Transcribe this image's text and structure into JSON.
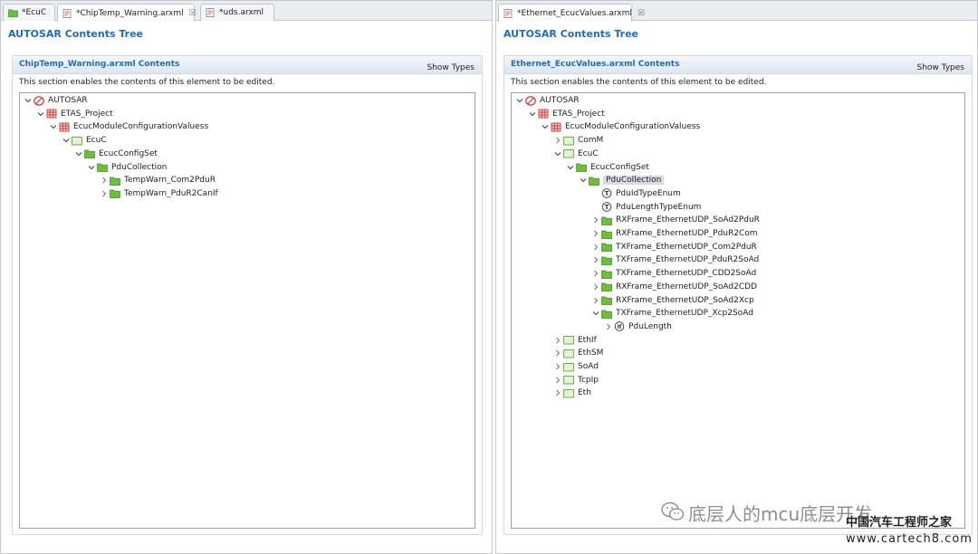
{
  "left_editor": {
    "tabs": [
      {
        "label": "*EcuC",
        "icon": "folder-icon",
        "closable": false
      },
      {
        "label": "*ChipTemp_Warning.arxml",
        "icon": "arxml-file-icon",
        "closable": true
      },
      {
        "label": "*uds.arxml",
        "icon": "arxml-file-icon",
        "closable": false
      }
    ],
    "close_glyph": "☒",
    "title": "AUTOSAR Contents Tree",
    "section_title": "ChipTemp_Warning.arxml Contents",
    "show_types": "Show Types",
    "description": "This section enables the contents of this element to be edited.",
    "tree": [
      {
        "label": "AUTOSAR",
        "depth": 0,
        "icon": "autosar-icon",
        "expander": "expanded"
      },
      {
        "label": "ETAS_Project",
        "depth": 1,
        "icon": "package-icon",
        "expander": "expanded"
      },
      {
        "label": "EcucModuleConfigurationValuess",
        "depth": 2,
        "icon": "package-icon",
        "expander": "expanded"
      },
      {
        "label": "EcuC",
        "depth": 3,
        "icon": "module-icon",
        "expander": "expanded"
      },
      {
        "label": "EcucConfigSet",
        "depth": 4,
        "icon": "folder-icon",
        "expander": "expanded"
      },
      {
        "label": "PduCollection",
        "depth": 5,
        "icon": "folder-icon",
        "expander": "expanded"
      },
      {
        "label": "TempWarn_Com2PduR",
        "depth": 6,
        "icon": "folder-icon",
        "expander": "collapsed"
      },
      {
        "label": "TempWarn_PduR2CanIf",
        "depth": 6,
        "icon": "folder-icon",
        "expander": "collapsed"
      }
    ]
  },
  "right_editor": {
    "tabs": [
      {
        "label": "*Ethernet_EcucValues.arxml",
        "icon": "arxml-file-icon",
        "closable": true
      }
    ],
    "close_glyph": "☒",
    "title": "AUTOSAR Contents Tree",
    "section_title": "Ethernet_EcucValues.arxml Contents",
    "show_types": "Show Types",
    "description": "This section enables the contents of this element to be edited.",
    "tree": [
      {
        "label": "AUTOSAR",
        "depth": 0,
        "icon": "autosar-icon",
        "expander": "expanded"
      },
      {
        "label": "ETAS_Project",
        "depth": 1,
        "icon": "package-icon",
        "expander": "expanded"
      },
      {
        "label": "EcucModuleConfigurationValuess",
        "depth": 2,
        "icon": "package-icon",
        "expander": "expanded"
      },
      {
        "label": "ComM",
        "depth": 3,
        "icon": "module-icon",
        "expander": "collapsed"
      },
      {
        "label": "EcuC",
        "depth": 3,
        "icon": "module-icon",
        "expander": "expanded"
      },
      {
        "label": "EcucConfigSet",
        "depth": 4,
        "icon": "folder-icon",
        "expander": "expanded"
      },
      {
        "label": "PduCollection",
        "depth": 5,
        "icon": "folder-icon",
        "expander": "expanded",
        "selected": true
      },
      {
        "label": "PduIdTypeEnum",
        "depth": 6,
        "icon": "enum-param-icon",
        "expander": "none"
      },
      {
        "label": "PduLengthTypeEnum",
        "depth": 6,
        "icon": "enum-param-icon",
        "expander": "none"
      },
      {
        "label": "RXFrame_EthernetUDP_SoAd2PduR",
        "depth": 6,
        "icon": "folder-icon",
        "expander": "collapsed"
      },
      {
        "label": "RXFrame_EthernetUDP_PduR2Com",
        "depth": 6,
        "icon": "folder-icon",
        "expander": "collapsed"
      },
      {
        "label": "TXFrame_EthernetUDP_Com2PduR",
        "depth": 6,
        "icon": "folder-icon",
        "expander": "collapsed"
      },
      {
        "label": "TXFrame_EthernetUDP_PduR2SoAd",
        "depth": 6,
        "icon": "folder-icon",
        "expander": "collapsed"
      },
      {
        "label": "TXFrame_EthernetUDP_CDD2SoAd",
        "depth": 6,
        "icon": "folder-icon",
        "expander": "collapsed"
      },
      {
        "label": "RXFrame_EthernetUDP_SoAd2CDD",
        "depth": 6,
        "icon": "folder-icon",
        "expander": "collapsed"
      },
      {
        "label": "RXFrame_EthernetUDP_SoAd2Xcp",
        "depth": 6,
        "icon": "folder-icon",
        "expander": "collapsed"
      },
      {
        "label": "TXFrame_EthernetUDP_Xcp2SoAd",
        "depth": 6,
        "icon": "folder-icon",
        "expander": "expanded"
      },
      {
        "label": "PduLength",
        "depth": 7,
        "icon": "int-param-icon",
        "expander": "collapsed"
      },
      {
        "label": "EthIf",
        "depth": 3,
        "icon": "module-icon",
        "expander": "collapsed"
      },
      {
        "label": "EthSM",
        "depth": 3,
        "icon": "module-icon",
        "expander": "collapsed"
      },
      {
        "label": "SoAd",
        "depth": 3,
        "icon": "module-icon",
        "expander": "collapsed"
      },
      {
        "label": "TcpIp",
        "depth": 3,
        "icon": "module-icon",
        "expander": "collapsed"
      },
      {
        "label": "Eth",
        "depth": 3,
        "icon": "module-icon",
        "expander": "collapsed"
      }
    ]
  },
  "watermark": {
    "wechat_text": "底层人的mcu底层开发",
    "site_name": "中国汽车工程师之家",
    "site_url": "www.cartech8.com"
  },
  "colors": {
    "title_blue": "#1f6bbf",
    "folder_green": "#6cbf3a",
    "package_red": "#d0312d",
    "selection": "#d9dde3"
  }
}
